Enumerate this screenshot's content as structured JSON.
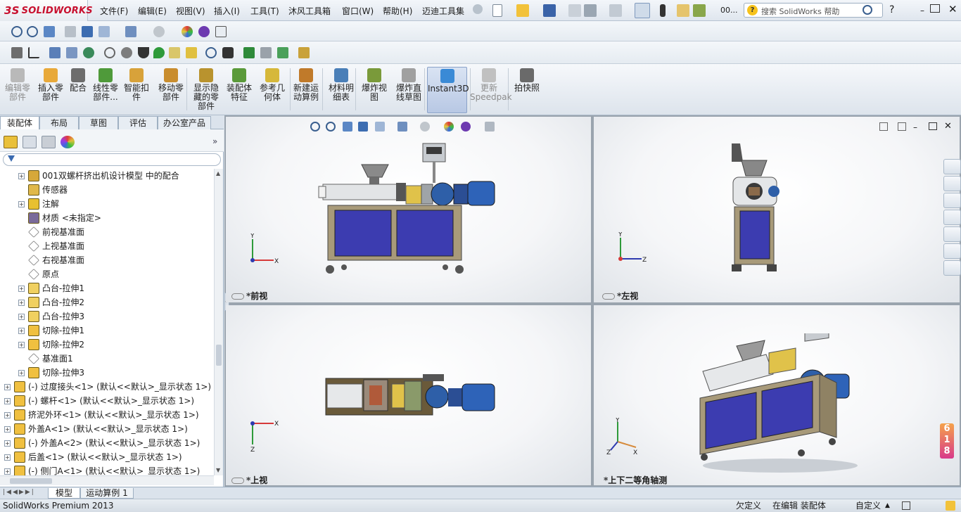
{
  "app": {
    "logo_text": "SOLIDWORKS",
    "logo_mark": "3S"
  },
  "menu": [
    "文件(F)",
    "编辑(E)",
    "视图(V)",
    "插入(I)",
    "工具(T)",
    "沐风工具箱",
    "窗口(W)",
    "帮助(H)",
    "迈迪工具集"
  ],
  "search": {
    "placeholder": "搜索 SolidWorks 帮助",
    "more": "00..."
  },
  "command_manager": [
    {
      "label1": "编辑零",
      "label2": "部件",
      "label3": "",
      "disabled": true,
      "color": "#b9b9b9"
    },
    {
      "label1": "插入零",
      "label2": "部件",
      "label3": "",
      "disabled": false,
      "color": "#e8a93a"
    },
    {
      "label1": "配合",
      "label2": "",
      "label3": "",
      "disabled": false,
      "color": "#6d6d6d"
    },
    {
      "label1": "线性零",
      "label2": "部件...",
      "label3": "",
      "disabled": false,
      "color": "#4f9a3a"
    },
    {
      "label1": "智能扣",
      "label2": "件",
      "label3": "",
      "disabled": false,
      "color": "#d8a23a"
    },
    {
      "label1": "移动零",
      "label2": "部件",
      "label3": "",
      "disabled": false,
      "color": "#c98d2e"
    },
    {
      "label1": "显示隐",
      "label2": "藏的零",
      "label3": "部件",
      "disabled": false,
      "color": "#b9932e"
    },
    {
      "label1": "装配体",
      "label2": "特征",
      "label3": "",
      "disabled": false,
      "color": "#5a9a3a"
    },
    {
      "label1": "参考几",
      "label2": "何体",
      "label3": "",
      "disabled": false,
      "color": "#d6b83a"
    },
    {
      "label1": "新建运",
      "label2": "动算例",
      "label3": "",
      "disabled": false,
      "color": "#c07a2a"
    },
    {
      "label1": "材料明",
      "label2": "细表",
      "label3": "",
      "disabled": false,
      "color": "#4a7fb8"
    },
    {
      "label1": "爆炸视",
      "label2": "图",
      "label3": "",
      "disabled": false,
      "color": "#7a9a3a"
    },
    {
      "label1": "爆炸直",
      "label2": "线草图",
      "label3": "",
      "disabled": false,
      "color": "#a0a0a0"
    },
    {
      "label1": "Instant3D",
      "label2": "",
      "label3": "",
      "disabled": false,
      "color": "#3a8ad6",
      "active": true
    },
    {
      "label1": "更新",
      "label2": "Speedpak",
      "label3": "",
      "disabled": true,
      "color": "#c0c0c0"
    },
    {
      "label1": "拍快照",
      "label2": "",
      "label3": "",
      "disabled": false,
      "color": "#6a6a6a"
    }
  ],
  "panel_tabs": [
    "装配体",
    "布局",
    "草图",
    "评估",
    "办公室产品"
  ],
  "tree": [
    {
      "text": "001双螺杆挤出机设计模型 中的配合",
      "indent": 1,
      "exp": true,
      "color": "#d6a83a"
    },
    {
      "text": "传感器",
      "indent": 1,
      "exp": false,
      "color": "#e0b84a"
    },
    {
      "text": "注解",
      "indent": 1,
      "exp": true,
      "color": "#e8c030"
    },
    {
      "text": "材质 <未指定>",
      "indent": 1,
      "exp": false,
      "color": "#7a6a9a"
    },
    {
      "text": "前视基准面",
      "indent": 1,
      "exp": false,
      "color": "#ffffff"
    },
    {
      "text": "上视基准面",
      "indent": 1,
      "exp": false,
      "color": "#ffffff"
    },
    {
      "text": "右视基准面",
      "indent": 1,
      "exp": false,
      "color": "#ffffff"
    },
    {
      "text": "原点",
      "indent": 1,
      "exp": false,
      "color": "#ffffff"
    },
    {
      "text": "凸台-拉伸1",
      "indent": 1,
      "exp": true,
      "color": "#f0d060"
    },
    {
      "text": "凸台-拉伸2",
      "indent": 1,
      "exp": true,
      "color": "#f0d060"
    },
    {
      "text": "凸台-拉伸3",
      "indent": 1,
      "exp": true,
      "color": "#f0d060"
    },
    {
      "text": "切除-拉伸1",
      "indent": 1,
      "exp": true,
      "color": "#f0c040"
    },
    {
      "text": "切除-拉伸2",
      "indent": 1,
      "exp": true,
      "color": "#f0c040"
    },
    {
      "text": "基准面1",
      "indent": 1,
      "exp": false,
      "color": "#ffffff"
    },
    {
      "text": "切除-拉伸3",
      "indent": 1,
      "exp": true,
      "color": "#f0c040"
    },
    {
      "text": "(-) 过度接头<1> (默认<<默认>_显示状态 1>)",
      "indent": 0,
      "exp": true,
      "color": "#f0c040"
    },
    {
      "text": "(-) 螺杆<1> (默认<<默认>_显示状态 1>)",
      "indent": 0,
      "exp": true,
      "color": "#f0c040"
    },
    {
      "text": "挤泥外环<1> (默认<<默认>_显示状态 1>)",
      "indent": 0,
      "exp": true,
      "color": "#f0c040"
    },
    {
      "text": "外盖A<1> (默认<<默认>_显示状态 1>)",
      "indent": 0,
      "exp": true,
      "color": "#f0c040"
    },
    {
      "text": "(-) 外盖A<2> (默认<<默认>_显示状态 1>)",
      "indent": 0,
      "exp": true,
      "color": "#f0c040"
    },
    {
      "text": "后盖<1> (默认<<默认>_显示状态 1>)",
      "indent": 0,
      "exp": true,
      "color": "#f0c040"
    },
    {
      "text": "(-) 侧门A<1> (默认<<默认>_显示状态 1>)",
      "indent": 0,
      "exp": true,
      "color": "#f0c040"
    }
  ],
  "viewports": {
    "front": "*前视",
    "left": "*左视",
    "top": "*上视",
    "iso": "*上下二等角轴测"
  },
  "triad": {
    "x": "X",
    "y": "Y",
    "z": "Z"
  },
  "bottom_tabs": [
    "模型",
    "运动算例 1"
  ],
  "status": {
    "product": "SolidWorks Premium 2013",
    "definition": "欠定义",
    "editing": "在编辑 装配体",
    "custom": "自定义"
  },
  "badge": [
    "6",
    "1",
    "8"
  ],
  "corner_badge": "81"
}
